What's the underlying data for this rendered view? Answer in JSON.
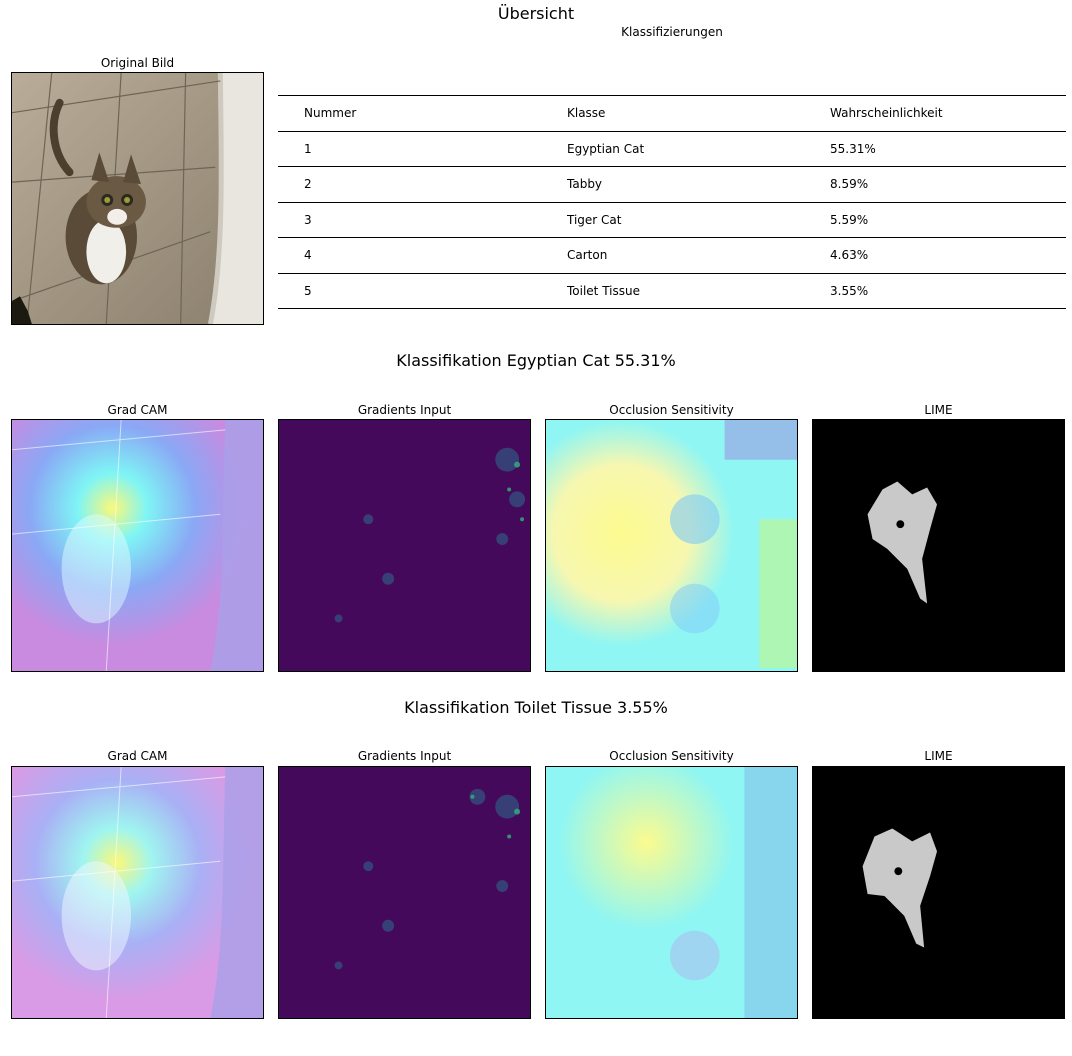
{
  "suptitle": "Übersicht",
  "original": {
    "title": "Original Bild"
  },
  "table": {
    "title": "Klassifizierungen",
    "headers": [
      "Nummer",
      "Klasse",
      "Wahrscheinlichkeit"
    ],
    "rows": [
      [
        "1",
        "Egyptian Cat",
        "55.31%"
      ],
      [
        "2",
        "Tabby",
        "8.59%"
      ],
      [
        "3",
        "Tiger Cat",
        "5.59%"
      ],
      [
        "4",
        "Carton",
        "4.63%"
      ],
      [
        "5",
        "Toilet Tissue",
        "3.55%"
      ]
    ]
  },
  "sections": [
    {
      "title": "Klassifikation Egyptian Cat 55.31%",
      "panels": [
        "Grad CAM",
        "Gradients Input",
        "Occlusion Sensitivity",
        "LIME"
      ]
    },
    {
      "title": "Klassifikation Toilet Tissue 3.55%",
      "panels": [
        "Grad CAM",
        "Gradients Input",
        "Occlusion Sensitivity",
        "LIME"
      ]
    }
  ],
  "colors": {
    "heatmap_low": "#3b3bd6",
    "heatmap_mid": "#7ff5f5",
    "heatmap_high": "#fbf87a",
    "viridis_bg": "#44095a",
    "lime_bg": "#000000"
  }
}
